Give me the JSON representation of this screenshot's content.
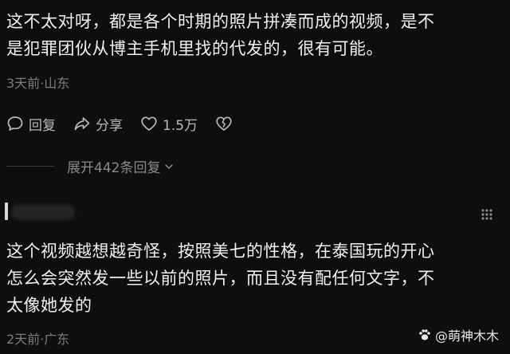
{
  "comment1": {
    "text_line1": "这不太对呀，都是各个时期的照片拼凑而成的视频，是不",
    "text_line2": "是犯罪团伙从博主手机里找的代发的，很有可能。",
    "meta": "3天前·山东",
    "actions": {
      "reply_label": "回复",
      "share_label": "分享",
      "like_count": "1.5万"
    }
  },
  "replies": {
    "expand_label": "展开442条回复"
  },
  "comment2": {
    "text_line1": "这个视频越想越奇怪，按照美七的性格，在泰国玩的开心",
    "text_line2": "怎么会突然发一些以前的照片，而且没有配任何文字，不",
    "text_line3": "太像她发的",
    "meta": "2天前·广东"
  },
  "watermark": {
    "text": "@萌神木木"
  },
  "icons": {
    "reply": "comment-bubble-icon",
    "share": "share-arrow-icon",
    "like": "heart-icon",
    "dislike": "broken-heart-icon",
    "expand": "chevron-down-icon",
    "more": "more-dots-icon"
  }
}
